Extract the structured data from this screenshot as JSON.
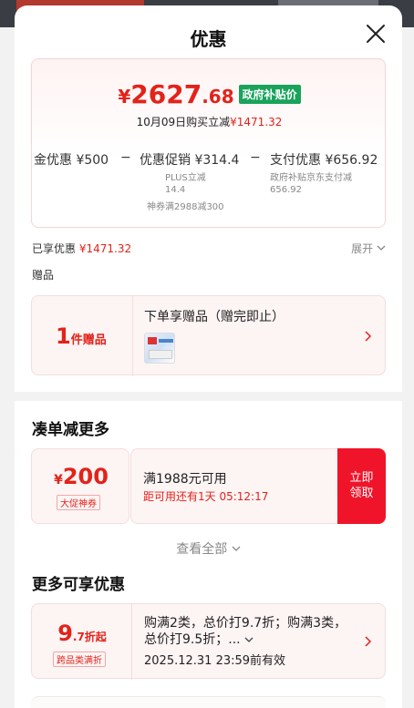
{
  "sheet": {
    "title": "优惠"
  },
  "price": {
    "yen": "¥",
    "int": "2627",
    "dec": ".68",
    "tag": "政府补贴价",
    "buy_prefix": "10月09日购买立减",
    "buy_amount": "¥1471.32"
  },
  "breakdown": {
    "gold_label": "金优惠",
    "gold_value": "¥500",
    "minus": "−",
    "promo_label": "优惠促销",
    "promo_value": "¥314.4",
    "promo_sub1": "PLUS立减",
    "promo_sub2": "14.4",
    "promo_sub3": "神券满2988减300",
    "pay_label": "支付优惠",
    "pay_value": "¥656.92",
    "pay_sub1": "政府补贴京东支付减",
    "pay_sub2": "656.92"
  },
  "enjoyed": {
    "label": "已享优惠",
    "amount": "¥1471.32",
    "expand": "展开"
  },
  "gifts": {
    "section_label": "赠品",
    "count": "1",
    "unit": "件赠品",
    "title": "下单享赠品（赠完即止）"
  },
  "bundle": {
    "heading": "凑单减更多",
    "coupon_yen": "¥",
    "coupon_amount": "200",
    "coupon_tag": "大促神券",
    "condition": "满1988元可用",
    "countdown": "距可用还有1天 05:12:17",
    "button_line1": "立即",
    "button_line2": "领取",
    "see_all": "查看全部"
  },
  "more": {
    "heading": "更多可享优惠",
    "discount_num": "9",
    "discount_unit": ".7折起",
    "tag": "跨品类满折",
    "desc": "购满2类，总价打9.7折；购满3类，总价打9.5折；...",
    "valid": "2025.12.31 23:59前有效"
  },
  "colors": {
    "accent": "#e2231a",
    "button": "#f0142a",
    "gov_tag": "#19a35b"
  },
  "icons": {
    "close": "close-icon",
    "chevron_down": "chevron-down-icon",
    "chevron_right": "chevron-right-icon"
  }
}
